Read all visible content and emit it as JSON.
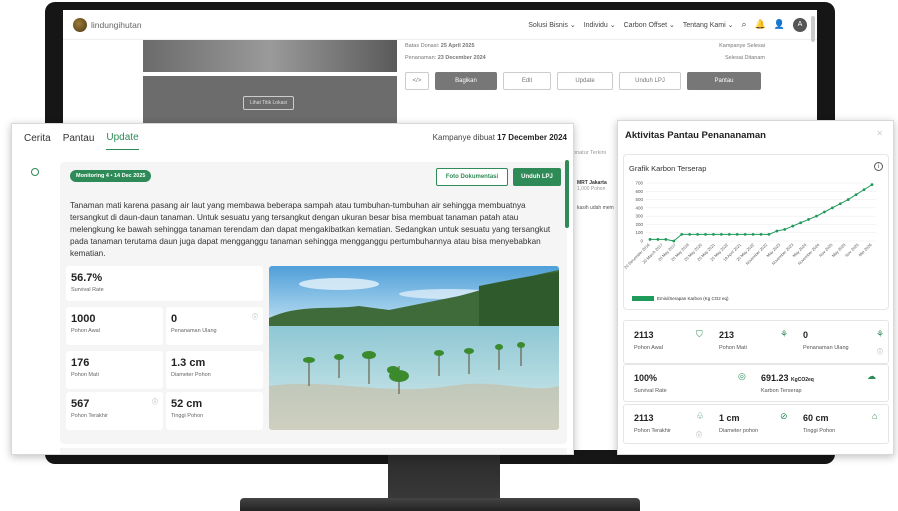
{
  "site": {
    "logo_text": "lindungihutan",
    "nav": [
      "Solusi Bisnis ⌄",
      "Individu ⌄",
      "Carbon Offset ⌄",
      "Tentang Kami ⌄"
    ],
    "avatar_initial": "A",
    "location_button": "Lihat Titik Lokasi",
    "donation_deadline_label": "Batas Donasi:",
    "donation_deadline": "25 April 2025",
    "campaign_status": "Kampanye Selesai",
    "planting_label": "Penanaman:",
    "planting_date": "23 December 2024",
    "planting_status": "Selesai Ditanam",
    "buttons": {
      "share": "Bagikan",
      "edit": "Edit",
      "update": "Update",
      "download_lpj": "Unduh LPJ",
      "monitor": "Pantau"
    },
    "side_text": "onatur Terkini",
    "side_name": "MRT Jakarta",
    "side_trees": "1,000 Pohon",
    "side_thanks": "kasih udah mem"
  },
  "left_panel": {
    "tabs": [
      "Cerita",
      "Pantau",
      "Update"
    ],
    "active_tab": "Update",
    "created_label": "Kampanye dibuat",
    "created_date": "17 December 2024",
    "badge": "Monitoring 4 • 14 Dec 2025",
    "doc_button": "Foto Dokumentasi",
    "lpj_button": "Unduh LPJ",
    "description": "Tanaman mati karena pasang air laut yang membawa beberapa sampah atau tumbuhan-tumbuhan air sehingga membuatnya tersangkut di daun-daun tanaman. Untuk sesuatu yang tersangkut dengan ukuran besar bisa membuat tanaman patah atau melengkung ke bawah sehingga tanaman terendam dan dapat mengakibatkan kematian. Sedangkan untuk sesuatu yang tersangkut pada tanaman terutama daun juga dapat mengganggu tanaman sehingga mengganggu pertumbuhannya atau bisa menyebabkan kematian.",
    "stats": {
      "survival": {
        "value": "56.7%",
        "label": "Survival Rate"
      },
      "initial": {
        "value": "1000",
        "label": "Pohon Awal"
      },
      "replant": {
        "value": "0",
        "label": "Penanaman Ulang"
      },
      "dead": {
        "value": "176",
        "label": "Pohon Mati"
      },
      "diameter": {
        "value": "1.3 cm",
        "label": "Diameter Pohon"
      },
      "last": {
        "value": "567",
        "label": "Pohon Terakhir"
      },
      "height": {
        "value": "52 cm",
        "label": "Tinggi Pohon"
      }
    }
  },
  "right_panel": {
    "title": "Aktivitas Pantau Penananaman",
    "chart_title": "Grafik Karbon Terserap",
    "metrics": {
      "initial": {
        "value": "2113",
        "label": "Pohon Awal",
        "icon": "tree-pot-icon"
      },
      "dead": {
        "value": "213",
        "label": "Pohon Mati",
        "icon": "dead-tree-icon"
      },
      "replant": {
        "value": "0",
        "label": "Penanaman Ulang",
        "icon": "replant-icon"
      },
      "survival": {
        "value": "100%",
        "label": "Survival Rate",
        "icon": "survival-icon"
      },
      "carbon": {
        "value": "691.23",
        "unit": "KgCO2eq",
        "label": "Karbon Terserap",
        "icon": "cloud-icon"
      },
      "last": {
        "value": "2113",
        "label": "Pohon Terakhir",
        "icon": "sprout-icon"
      },
      "diameter": {
        "value": "1 cm",
        "label": "Diameter pohon",
        "icon": "diameter-icon"
      },
      "height": {
        "value": "60 cm",
        "label": "Tinggi Pohon",
        "icon": "height-icon"
      }
    }
  },
  "chart_data": {
    "type": "line",
    "title": "Grafik Karbon Terserap",
    "x": [
      "20 December 2016",
      "20 March 2017",
      "20 May 2017",
      "20 May 2019",
      "20 May 2020",
      "20 May 2021",
      "20 May 2022",
      "19 April 2021",
      "20 May 2022",
      "November 2022",
      "May 2023",
      "November 2023",
      "May 2024",
      "November 2024",
      "Nov 2025",
      "May 2025",
      "Nov 2025",
      "Mei 2026"
    ],
    "series": [
      {
        "name": "Emisi/Serapan Karbon (Kg CO2 eq)",
        "color": "#1e9a5a",
        "values": [
          20,
          20,
          20,
          0,
          80,
          80,
          80,
          80,
          80,
          80,
          80,
          80,
          80,
          80,
          80,
          80,
          120,
          140,
          180,
          220,
          260,
          300,
          350,
          400,
          450,
          500,
          560,
          620,
          680
        ]
      }
    ],
    "ylim": [
      0,
      700
    ],
    "yticks": [
      0,
      100,
      200,
      300,
      400,
      500,
      600,
      700
    ],
    "grid": true,
    "legend": "bottom-left"
  }
}
